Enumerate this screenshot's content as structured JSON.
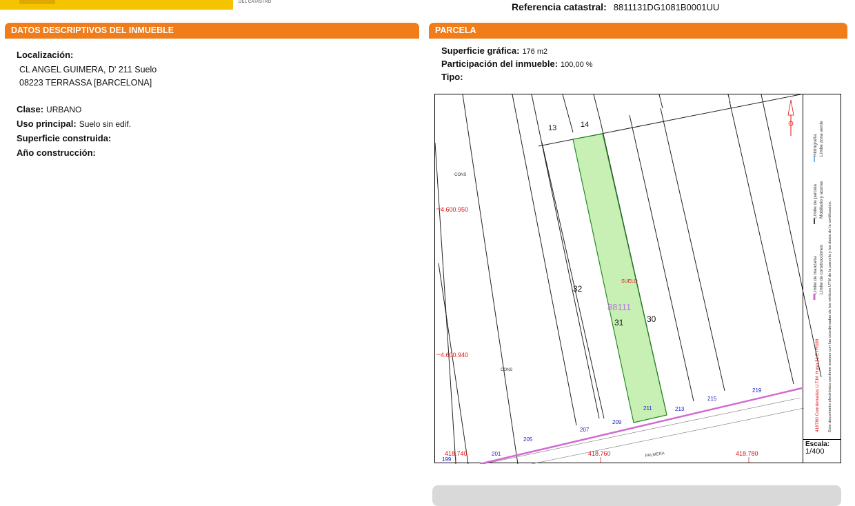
{
  "header": {
    "ref_label": "Referencia catastral:",
    "ref_value": "8811131DG1081B0001UU",
    "logo_small_text": "DEL CATASTRO"
  },
  "left": {
    "title": "DATOS DESCRIPTIVOS DEL INMUEBLE",
    "localizacion_label": "Localización:",
    "address_line1": "CL ANGEL GUIMERA, D' 211 Suelo",
    "address_line2": "08223 TERRASSA [BARCELONA]",
    "clase_label": "Clase:",
    "clase_value": "URBANO",
    "uso_label": "Uso principal:",
    "uso_value": "Suelo sin edif.",
    "superficie_label": "Superficie construida:",
    "anio_label": "Año construcción:"
  },
  "right": {
    "title": "PARCELA",
    "sup_grafica_label": "Superficie gráfica:",
    "sup_grafica_value": "176 m2",
    "participacion_label": "Participación del inmueble:",
    "participacion_value": "100,00 %",
    "tipo_label": "Tipo:"
  },
  "map": {
    "parcel_numbers": [
      "13",
      "14",
      "32",
      "31",
      "30"
    ],
    "parcel_ref": "88111",
    "suelo_label": "SUELO",
    "cons_labels": [
      "CONS",
      "CONS"
    ],
    "street_numbers": [
      "199",
      "201",
      "205",
      "207",
      "209",
      "211",
      "213",
      "215",
      "219"
    ],
    "coord_y": [
      "4.600.950",
      "4.600.940"
    ],
    "coord_x": [
      "418.740",
      "418.760",
      "418.780"
    ],
    "street_name": "PALMERA",
    "legend": {
      "rotated_line1": "418780 Coordenadas U.T.M. Huso 31 ETRS89",
      "rotated_line2": "Este documento electrónico contiene anexos con las coordenadas de los vértices UTM de la parcela y los datos de la certificación.",
      "items": [
        "Límite de manzana",
        "Límite de parcela",
        "Hidrografía",
        "Límite de construcciones",
        "Mobiliario y aceras",
        "Límite zona verde"
      ]
    },
    "scale_label": "Escala:",
    "scale_value": "1/400",
    "colors": {
      "parcel_fill": "#c8f0b4",
      "parcel_stroke": "#228b22",
      "boundary": "#d26ad2",
      "coord": "#d11",
      "street": "#1a1acc"
    }
  }
}
